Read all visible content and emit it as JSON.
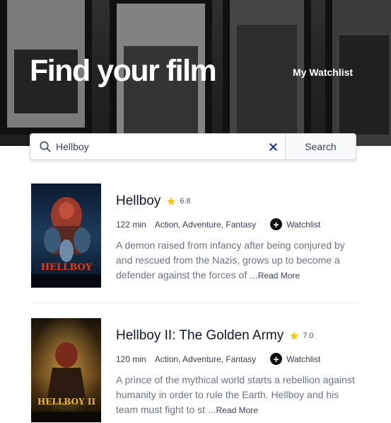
{
  "header": {
    "title": "Find your film",
    "watchlist_link": "My Watchlist"
  },
  "search": {
    "value": "Hellboy",
    "placeholder": "",
    "button_label": "Search",
    "clear_icon": "close-icon",
    "search_icon": "search-icon"
  },
  "results": [
    {
      "title": "Hellboy",
      "rating": "6.8",
      "runtime": "122 min",
      "genres": "Action, Adventure, Fantasy",
      "watchlist_label": "Watchlist",
      "plot": "A demon raised from infancy after being conjured by and rescued from the Nazis, grows up to become a defender against the forces of ...",
      "read_more": "Read More",
      "poster_text": "HELLBOY"
    },
    {
      "title": "Hellboy II: The Golden Army",
      "rating": "7.0",
      "runtime": "120 min",
      "genres": "Action, Adventure, Fantasy",
      "watchlist_label": "Watchlist",
      "plot": "A prince of the mythical world starts a rebellion against humanity in order to rule the Earth. Hellboy and his team must fight to st ...",
      "read_more": "Read More",
      "poster_text": "HELLBOY II"
    }
  ],
  "colors": {
    "star": "#f5c518",
    "clear_icon": "#1e3a8a"
  }
}
